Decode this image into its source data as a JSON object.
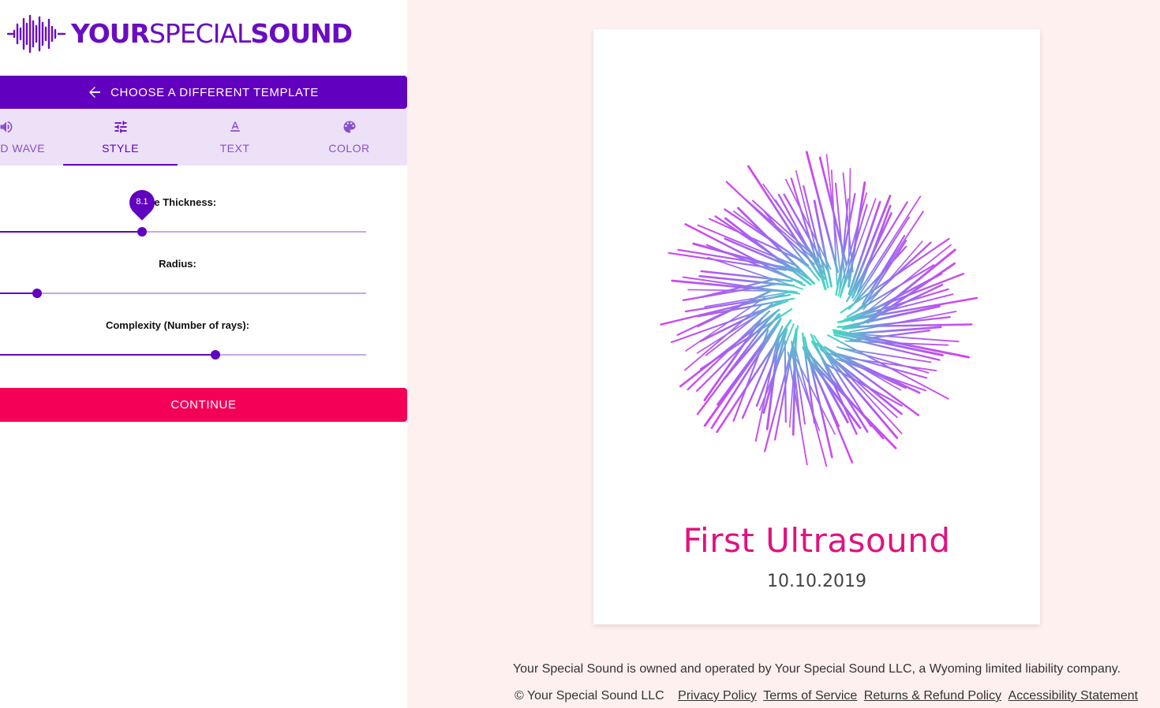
{
  "brand": {
    "name_bold_1": "YOUR",
    "name_light": "SPECIAL",
    "name_bold_2": "SOUND",
    "color": "#6a0dc2"
  },
  "header": {
    "back_button_label": "CHOOSE A DIFFERENT TEMPLATE",
    "back_icon": "arrow-left-icon"
  },
  "tabs": [
    {
      "label": "SOUND WAVE",
      "icon": "volume-icon",
      "active": false
    },
    {
      "label": "STYLE",
      "icon": "tune-icon",
      "active": true
    },
    {
      "label": "TEXT",
      "icon": "text-format-icon",
      "active": false
    },
    {
      "label": "COLOR",
      "icon": "palette-icon",
      "active": false
    }
  ],
  "sliders": {
    "line_thickness": {
      "label": "Line Thickness:",
      "value": "8.1",
      "fraction": 0.388
    },
    "radius": {
      "label": "Radius:",
      "fraction": 0.101
    },
    "complexity": {
      "label": "Complexity (Number of rays):",
      "fraction": 0.588
    }
  },
  "actions": {
    "continue_label": "CONTINUE"
  },
  "poster": {
    "title": "First Ultrasound",
    "date": "10.10.2019",
    "gradient_inner": "#3fe0c0",
    "gradient_mid": "#9a6bf0",
    "gradient_outer": "#d940f0"
  },
  "footer": {
    "statement": "Your Special Sound is owned and operated by Your Special Sound LLC, a Wyoming limited liability company.",
    "copyright": "© Your Special Sound LLC",
    "links": [
      "Privacy Policy",
      "Terms of Service",
      "Returns & Refund Policy",
      "Accessibility Statement"
    ]
  },
  "colors": {
    "primary": "#6200c0",
    "accent": "#f50057",
    "tab_bg": "#ede1f8",
    "preview_bg": "#fff0f0"
  }
}
